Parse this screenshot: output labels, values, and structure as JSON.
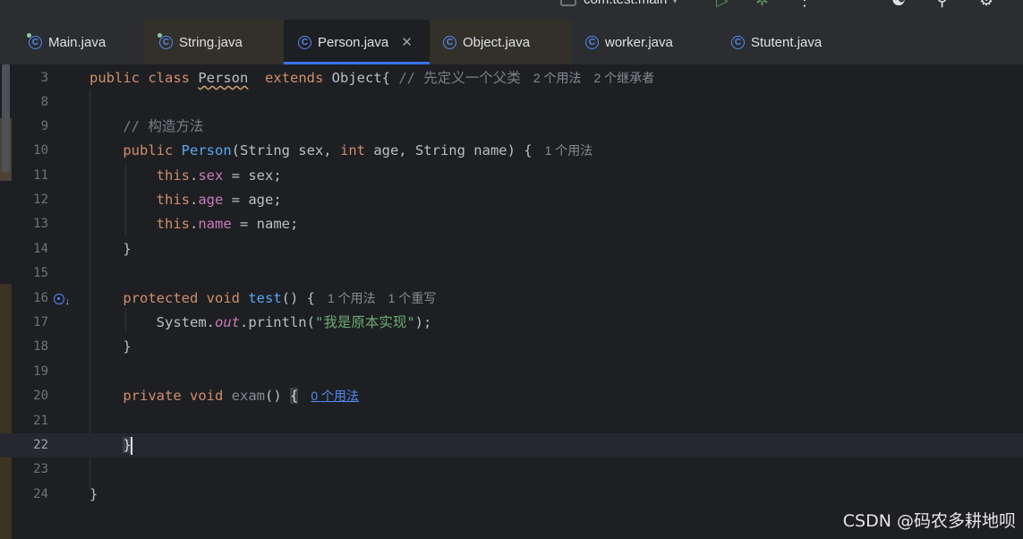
{
  "toolbar": {
    "project_label": "com.test.main",
    "run_icon": "run-icon",
    "debug_icon": "debug-icon",
    "more_icon": "more-icon",
    "add_user_icon": "add-user-icon",
    "search_icon": "search-icon",
    "settings_icon": "gear-icon"
  },
  "tabs": [
    {
      "label": "Main.java",
      "icon": "java-class-run-icon",
      "state": "normal"
    },
    {
      "label": "String.java",
      "icon": "java-class-run-icon",
      "state": "modified"
    },
    {
      "label": "Person.java",
      "icon": "java-class-icon",
      "state": "active",
      "closable": true
    },
    {
      "label": "Object.java",
      "icon": "java-class-icon",
      "state": "modified"
    },
    {
      "label": "worker.java",
      "icon": "java-class-icon",
      "state": "normal"
    },
    {
      "label": "Stutent.java",
      "icon": "java-class-icon",
      "state": "normal"
    }
  ],
  "editor": {
    "current_line": "22",
    "lines": [
      {
        "n": "3",
        "tokens": [
          [
            "kw",
            "public "
          ],
          [
            "kw",
            "class "
          ],
          [
            "warn",
            "Person"
          ],
          [
            "",
            "  "
          ],
          [
            "kw",
            "extends "
          ],
          [
            "",
            "Object{ "
          ],
          [
            "cmt",
            "// 先定义一个父类"
          ]
        ],
        "hints": [
          "2 个用法",
          "2 个继承者"
        ]
      },
      {
        "n": "8",
        "tokens": [],
        "hints": []
      },
      {
        "n": "9",
        "tokens": [
          [
            "",
            "    "
          ],
          [
            "cmt",
            "// 构造方法"
          ]
        ],
        "hints": []
      },
      {
        "n": "10",
        "tokens": [
          [
            "",
            "    "
          ],
          [
            "kw",
            "public "
          ],
          [
            "cls-def",
            "Person"
          ],
          [
            "",
            "(String sex, "
          ],
          [
            "kw",
            "int "
          ],
          [
            "",
            "age, String name) {"
          ]
        ],
        "hints": [
          "1 个用法"
        ]
      },
      {
        "n": "11",
        "tokens": [
          [
            "",
            "        "
          ],
          [
            "kw",
            "this"
          ],
          [
            "",
            "."
          ],
          [
            "fld",
            "sex"
          ],
          [
            "",
            " = sex;"
          ]
        ],
        "hints": []
      },
      {
        "n": "12",
        "tokens": [
          [
            "",
            "        "
          ],
          [
            "kw",
            "this"
          ],
          [
            "",
            "."
          ],
          [
            "fld",
            "age"
          ],
          [
            "",
            " = age;"
          ]
        ],
        "hints": []
      },
      {
        "n": "13",
        "tokens": [
          [
            "",
            "        "
          ],
          [
            "kw",
            "this"
          ],
          [
            "",
            "."
          ],
          [
            "fld",
            "name"
          ],
          [
            "",
            " = name;"
          ]
        ],
        "hints": []
      },
      {
        "n": "14",
        "tokens": [
          [
            "",
            "    }"
          ]
        ],
        "hints": []
      },
      {
        "n": "15",
        "tokens": [],
        "hints": []
      },
      {
        "n": "16",
        "tokens": [
          [
            "",
            "    "
          ],
          [
            "kw",
            "protected "
          ],
          [
            "kw",
            "void "
          ],
          [
            "cls-def",
            "test"
          ],
          [
            "",
            "() {"
          ]
        ],
        "hints": [
          "1 个用法",
          "1 个重写"
        ],
        "gutter_icon": "overridden-method-icon"
      },
      {
        "n": "17",
        "tokens": [
          [
            "",
            "        System."
          ],
          [
            "stat",
            "out"
          ],
          [
            "",
            ".println("
          ],
          [
            "str",
            "\"我是原本实现\""
          ],
          [
            "",
            ");"
          ]
        ],
        "hints": []
      },
      {
        "n": "18",
        "tokens": [
          [
            "",
            "    }"
          ]
        ],
        "hints": []
      },
      {
        "n": "19",
        "tokens": [],
        "hints": []
      },
      {
        "n": "20",
        "tokens": [
          [
            "",
            "    "
          ],
          [
            "kw",
            "private "
          ],
          [
            "kw",
            "void "
          ],
          [
            "unused",
            "exam"
          ],
          [
            "",
            "() "
          ],
          [
            "brace-hl",
            "{"
          ]
        ],
        "hints": [],
        "link_hint": "0 个用法"
      },
      {
        "n": "21",
        "tokens": [],
        "hints": []
      },
      {
        "n": "22",
        "tokens": [
          [
            "",
            "    "
          ],
          [
            "brace-hl",
            "}"
          ]
        ],
        "hints": [],
        "caret": true
      },
      {
        "n": "23",
        "tokens": [],
        "hints": []
      },
      {
        "n": "24",
        "tokens": [
          [
            "",
            "}"
          ]
        ],
        "hints": []
      }
    ]
  },
  "watermark": "CSDN @码农多耕地呗",
  "colors": {
    "editor_bg": "#1e1f22",
    "tabbar_bg": "#2b2d30",
    "keyword": "#cf8e6d",
    "method": "#56a8f5",
    "field": "#c77dbb",
    "string": "#6aab73",
    "comment": "#7a7e85",
    "accent": "#3574f0"
  }
}
